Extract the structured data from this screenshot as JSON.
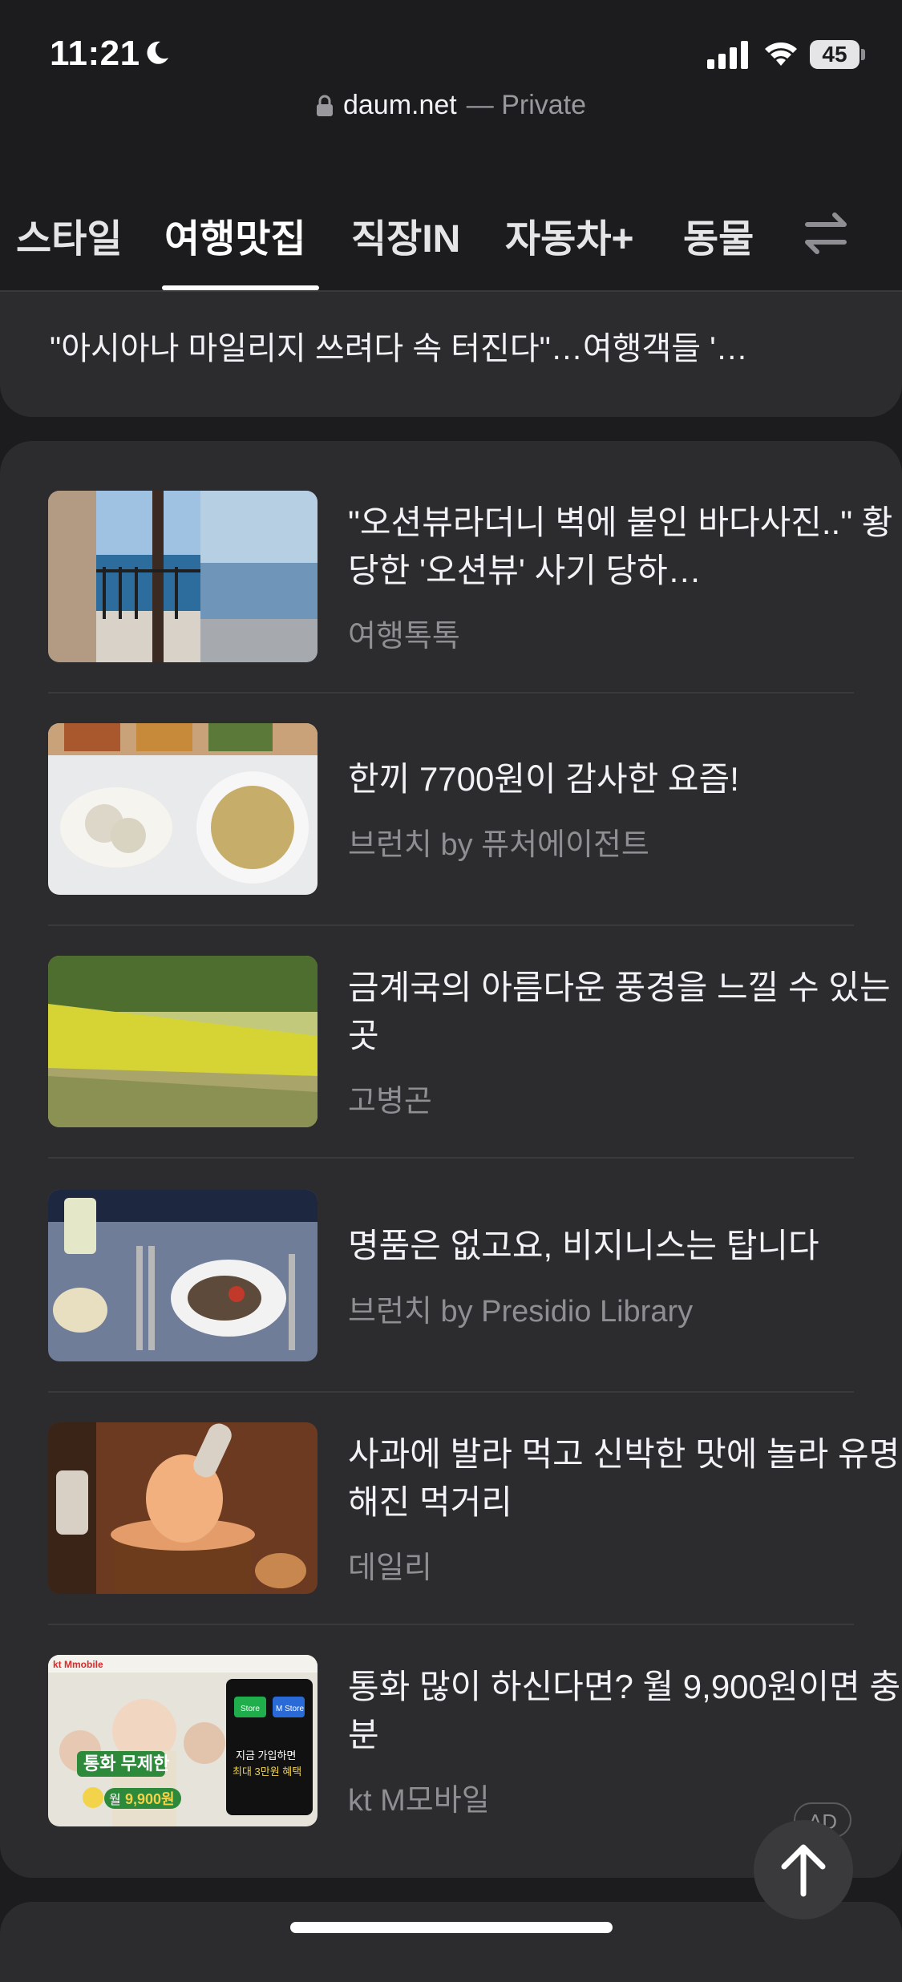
{
  "status_bar": {
    "time": "11:21",
    "battery": "45"
  },
  "browser": {
    "domain": "daum.net",
    "private_label": "— Private"
  },
  "tabs": [
    {
      "label": "스타일",
      "active": false
    },
    {
      "label": "여행맛집",
      "active": true
    },
    {
      "label": "직장IN",
      "active": false
    },
    {
      "label": "자동차+",
      "active": false
    },
    {
      "label": "동물",
      "active": false
    }
  ],
  "headline": "\"아시아나 마일리지 쓰려다 속 터진다\"…여행객들 '…",
  "articles": [
    {
      "title": "\"오션뷰라더니 벽에 붙인 바다사진..\" 황당한 '오션뷰' 사기 당하…",
      "source": "여행톡톡"
    },
    {
      "title": "한끼 7700원이 감사한 요즘!",
      "source": "브런치 by 퓨처에이전트"
    },
    {
      "title": "금계국의 아름다운 풍경을 느낄 수 있는 곳",
      "source": "고병곤"
    },
    {
      "title": "명품은 없고요, 비지니스는 탑니다",
      "source": "브런치 by Presidio Library"
    },
    {
      "title": "사과에 발라 먹고 신박한 맛에 놀라 유명해진 먹거리",
      "source": "데일리"
    },
    {
      "title": "통화 많이 하신다면? 월 9,900원이면 충분",
      "source": "kt M모바일",
      "ad_label": "AD"
    }
  ],
  "ad_thumb": {
    "brand": "kt Mmobile",
    "banner": "통화 무제한",
    "price_prefix": "월",
    "price": "9,900원",
    "store1": "Store",
    "store2": "M Store",
    "promo1": "지금 가입하면",
    "promo2": "최대 3만원 혜택"
  },
  "colors": {
    "background": "#1c1c1e",
    "card": "#2c2c2e",
    "secondary_text": "#8e8e93"
  }
}
